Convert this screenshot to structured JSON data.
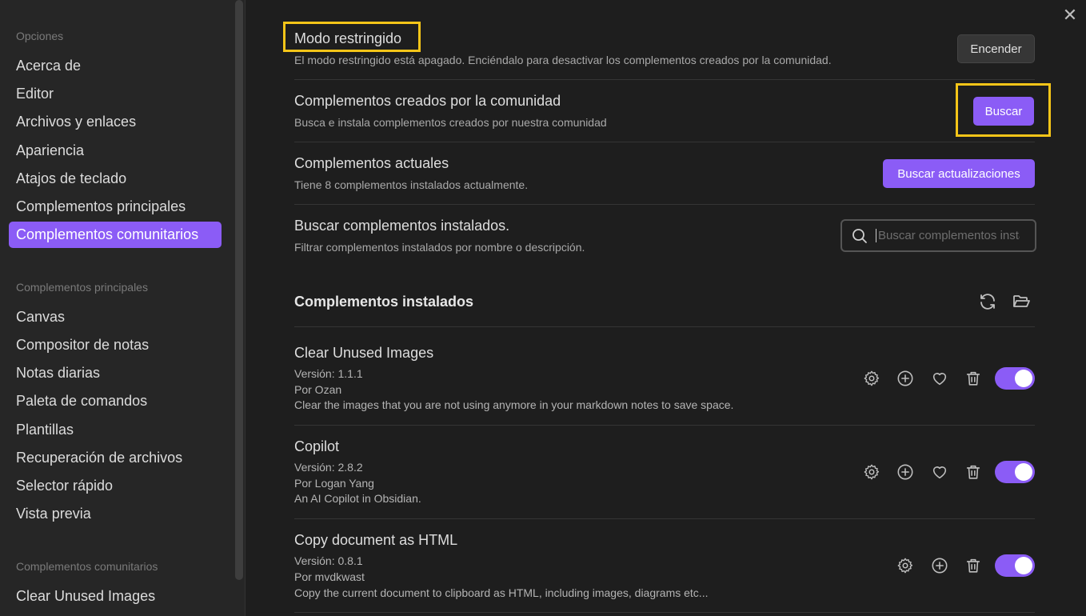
{
  "sidebar": {
    "group_options": "Opciones",
    "options": [
      {
        "label": "Acerca de"
      },
      {
        "label": "Editor"
      },
      {
        "label": "Archivos y enlaces"
      },
      {
        "label": "Apariencia"
      },
      {
        "label": "Atajos de teclado"
      },
      {
        "label": "Complementos principales"
      },
      {
        "label": "Complementos comunitarios"
      }
    ],
    "group_core": "Complementos principales",
    "core": [
      {
        "label": "Canvas"
      },
      {
        "label": "Compositor de notas"
      },
      {
        "label": "Notas diarias"
      },
      {
        "label": "Paleta de comandos"
      },
      {
        "label": "Plantillas"
      },
      {
        "label": "Recuperación de archivos"
      },
      {
        "label": "Selector rápido"
      },
      {
        "label": "Vista previa"
      }
    ],
    "group_community": "Complementos comunitarios",
    "community": [
      {
        "label": "Clear Unused Images"
      }
    ]
  },
  "main": {
    "close_glyph": "✕",
    "restricted": {
      "title": "Modo restringido",
      "desc": "El modo restringido está apagado. Enciéndalo para desactivar los complementos creados por la comunidad.",
      "button": "Encender"
    },
    "community": {
      "title": "Complementos creados por la comunidad",
      "desc": "Busca e instala complementos creados por nuestra comunidad",
      "button": "Buscar"
    },
    "current": {
      "title": "Complementos actuales",
      "desc": "Tiene 8 complementos instalados actualmente.",
      "button": "Buscar actualizaciones"
    },
    "search": {
      "title": "Buscar complementos instalados.",
      "desc": "Filtrar complementos instalados por nombre o descripción.",
      "placeholder": "Buscar complementos instalados..."
    },
    "installed_heading": "Complementos instalados",
    "plugins": [
      {
        "name": "Clear Unused Images",
        "version": "Versión: 1.1.1",
        "author": "Por Ozan",
        "desc": "Clear the images that you are not using anymore in your markdown notes to save space.",
        "enabled": true
      },
      {
        "name": "Copilot",
        "version": "Versión: 2.8.2",
        "author": "Por Logan Yang",
        "desc": "An AI Copilot in Obsidian.",
        "enabled": true
      },
      {
        "name": "Copy document as HTML",
        "version": "Versión: 0.8.1",
        "author": "Por mvdkwast",
        "desc": "Copy the current document to clipboard as HTML, including images, diagrams etc...",
        "enabled": true
      }
    ]
  },
  "colors": {
    "accent": "#8b5cf6",
    "highlight": "#f5c518",
    "background": "#1e1e1e",
    "sidebar": "#262626"
  }
}
